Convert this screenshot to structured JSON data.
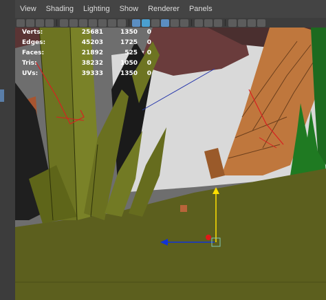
{
  "menu": {
    "items": [
      "View",
      "Shading",
      "Lighting",
      "Show",
      "Renderer",
      "Panels"
    ]
  },
  "toolbar": {
    "icons": [
      "camera-icon",
      "lock-camera-icon",
      "bookmark-icon",
      "image-plane-icon",
      "grid-icon",
      "film-gate-icon",
      "resolution-gate-icon",
      "gate-mask-icon",
      "field-chart-icon",
      "safe-action-icon",
      "safe-title-icon",
      "wireframe-icon",
      "smooth-shade-icon",
      "shade-wire-icon",
      "textured-icon",
      "lights-icon",
      "shadows-icon",
      "ambient-occlusion-icon",
      "antialias-icon",
      "depth-of-field-icon",
      "isolate-icon",
      "xray-icon",
      "xray-joints-icon",
      "backface-icon"
    ]
  },
  "hud": {
    "rows": [
      {
        "label": "Verts:",
        "total": "25681",
        "selected": "1350",
        "extra": "0"
      },
      {
        "label": "Edges:",
        "total": "45203",
        "selected": "1725",
        "extra": "0"
      },
      {
        "label": "Faces:",
        "total": "21892",
        "selected": "525",
        "extra": "0"
      },
      {
        "label": "Tris:",
        "total": "38232",
        "selected": "1050",
        "extra": "0"
      },
      {
        "label": "UVs:",
        "total": "39333",
        "selected": "1350",
        "extra": "0"
      }
    ]
  },
  "colors": {
    "ground": "#5c5f1e",
    "grass": "#6d7422",
    "wall": "#d8d8d8",
    "wood": "#b86a34",
    "manipulator_y": "#ffe000",
    "manipulator_x": "#1033d8",
    "manipulator_center": "#e01818"
  }
}
